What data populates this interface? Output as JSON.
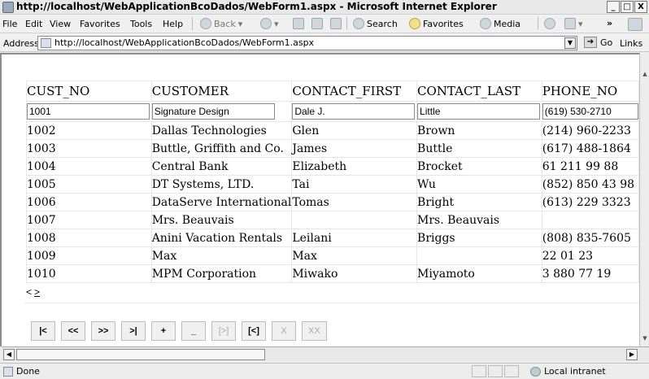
{
  "window": {
    "title": "http://localhost/WebApplicationBcoDados/WebForm1.aspx - Microsoft Internet Explorer",
    "min_btn": "_",
    "max_btn": "□",
    "close_btn": "X"
  },
  "menu": [
    "File",
    "Edit",
    "View",
    "Favorites",
    "Tools",
    "Help"
  ],
  "toolbar": {
    "back": "Back",
    "search": "Search",
    "favorites": "Favorites",
    "media": "Media",
    "chevron": "»"
  },
  "address": {
    "label": "Address",
    "url": "http://localhost/WebApplicationBcoDados/WebForm1.aspx",
    "go": "Go",
    "links": "Links"
  },
  "grid": {
    "headers": [
      "CUST_NO",
      "CUSTOMER",
      "CONTACT_FIRST",
      "CONTACT_LAST",
      "PHONE_NO"
    ],
    "edit_row": [
      "1001",
      "Signature Design",
      "Dale J.",
      "Little",
      "(619) 530-2710"
    ],
    "rows": [
      [
        "1002",
        "Dallas Technologies",
        "Glen",
        "Brown",
        "(214) 960-2233"
      ],
      [
        "1003",
        "Buttle, Griffith and Co.",
        "James",
        "Buttle",
        "(617) 488-1864"
      ],
      [
        "1004",
        "Central Bank",
        "Elizabeth",
        "Brocket",
        "61 211 99 88"
      ],
      [
        "1005",
        "DT Systems, LTD.",
        "Tai",
        "Wu",
        "(852) 850 43 98"
      ],
      [
        "1006",
        "DataServe International",
        "Tomas",
        "Bright",
        "(613) 229 3323"
      ],
      [
        "1007",
        "Mrs. Beauvais",
        "",
        "Mrs. Beauvais",
        ""
      ],
      [
        "1008",
        "Anini Vacation Rentals",
        "Leilani",
        "Briggs",
        "(808) 835-7605"
      ],
      [
        "1009",
        "Max",
        "Max",
        "",
        "22 01 23"
      ],
      [
        "1010",
        "MPM Corporation",
        "Miwako",
        "Miyamoto",
        "3 880 77 19"
      ]
    ],
    "pager_prev": "<",
    "pager_next": ">"
  },
  "nav_buttons": [
    "|<",
    "<<",
    ">>",
    ">|",
    "+",
    "_",
    "[>]",
    "[<]",
    "X",
    "XX"
  ],
  "status": {
    "text": "Done",
    "zone": "Local intranet"
  }
}
